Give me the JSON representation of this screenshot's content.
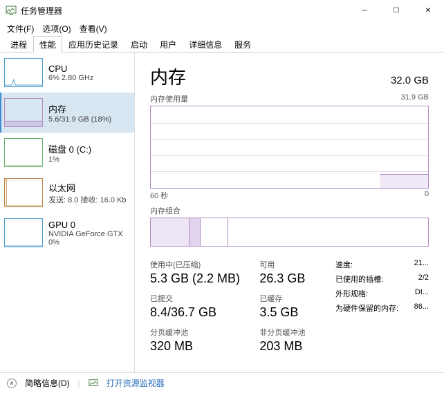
{
  "window": {
    "title": "任务管理器"
  },
  "menu": [
    "文件(F)",
    "选项(O)",
    "查看(V)"
  ],
  "tabs": [
    "进程",
    "性能",
    "应用历史记录",
    "启动",
    "用户",
    "详细信息",
    "服务"
  ],
  "active_tab": 1,
  "sidebar": {
    "cpu": {
      "name": "CPU",
      "sub": "6% 2.80 GHz"
    },
    "mem": {
      "name": "内存",
      "sub": "5.6/31.9 GB (18%)"
    },
    "disk": {
      "name": "磁盘 0 (C:)",
      "sub": "1%"
    },
    "net": {
      "name": "以太网",
      "sub": "发送: 8.0 接收: 16.0 Kb"
    },
    "gpu": {
      "name": "GPU 0",
      "sub1": "NVIDIA GeForce GTX",
      "sub2": "0%"
    }
  },
  "main": {
    "title": "内存",
    "total": "32.0 GB",
    "usage_label": "内存使用量",
    "usage_max": "31.9 GB",
    "axis_left": "60 秒",
    "axis_right": "0",
    "comp_label": "内存组合",
    "stats": {
      "in_use_label": "使用中(已压缩)",
      "in_use": "5.3 GB (2.2 MB)",
      "avail_label": "可用",
      "avail": "26.3 GB",
      "commit_label": "已提交",
      "commit": "8.4/36.7 GB",
      "cached_label": "已缓存",
      "cached": "3.5 GB",
      "paged_label": "分页缓冲池",
      "paged": "320 MB",
      "nonpaged_label": "非分页缓冲池",
      "nonpaged": "203 MB"
    },
    "r": {
      "speed_l": "速度:",
      "speed_v": "21...",
      "slots_l": "已使用的插槽:",
      "slots_v": "2/2",
      "form_l": "外形规格:",
      "form_v": "DI...",
      "hw_l": "为硬件保留的内存:",
      "hw_v": "86..."
    }
  },
  "status": {
    "less": "简略信息(D)",
    "open": "打开资源监视器"
  }
}
